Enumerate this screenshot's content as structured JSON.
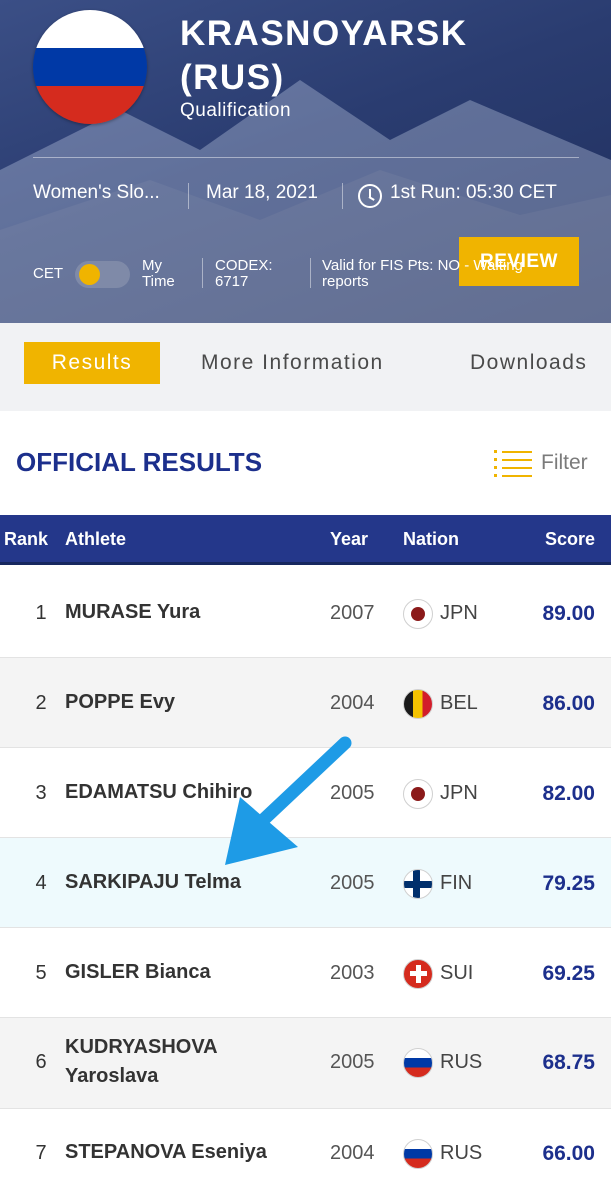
{
  "event": {
    "title_line1": "KRASNOYARSK",
    "title_line2": "(RUS)",
    "subtitle": "Qualification",
    "discipline": "Women's Slo...",
    "date": "Mar 18, 2021",
    "run_time": "1st Run: 05:30 CET",
    "flag_colors": [
      "#ffffff",
      "#0039a6",
      "#d52b1e"
    ]
  },
  "controls": {
    "cet_label": "CET",
    "my_time_line1": "My",
    "my_time_line2": "Time",
    "codex_line1": "CODEX:",
    "codex_line2": "6717",
    "valid_line1": "Valid for FIS Pts: NO - Waiting",
    "valid_line2": "reports",
    "review_label": "REVIEW"
  },
  "tabs": [
    {
      "label": "Results",
      "active": true
    },
    {
      "label": "More Information",
      "active": false
    },
    {
      "label": "Downloads",
      "active": false
    }
  ],
  "results": {
    "title": "OFFICIAL RESULTS",
    "filter_label": "Filter"
  },
  "table": {
    "headers": {
      "rank": "Rank",
      "athlete": "Athlete",
      "year": "Year",
      "nation": "Nation",
      "score": "Score"
    },
    "rows": [
      {
        "rank": "1",
        "athlete": "MURASE Yura",
        "year": "2007",
        "nation": "JPN",
        "score": "89.00"
      },
      {
        "rank": "2",
        "athlete": "POPPE Evy",
        "year": "2004",
        "nation": "BEL",
        "score": "86.00"
      },
      {
        "rank": "3",
        "athlete": "EDAMATSU Chihiro",
        "year": "2005",
        "nation": "JPN",
        "score": "82.00"
      },
      {
        "rank": "4",
        "athlete": "SARKIPAJU Telma",
        "year": "2005",
        "nation": "FIN",
        "score": "79.25"
      },
      {
        "rank": "5",
        "athlete": "GISLER Bianca",
        "year": "2003",
        "nation": "SUI",
        "score": "69.25"
      },
      {
        "rank": "6",
        "athlete": "KUDRYASHOVA Yaroslava",
        "year": "2005",
        "nation": "RUS",
        "score": "68.75"
      },
      {
        "rank": "7",
        "athlete": "STEPANOVA Eseniya",
        "year": "2004",
        "nation": "RUS",
        "score": "66.00"
      }
    ]
  },
  "colors": {
    "accent": "#f0b400",
    "header_blue": "#24378a",
    "title_blue": "#1c2f8c",
    "arrow": "#1e9be6"
  }
}
